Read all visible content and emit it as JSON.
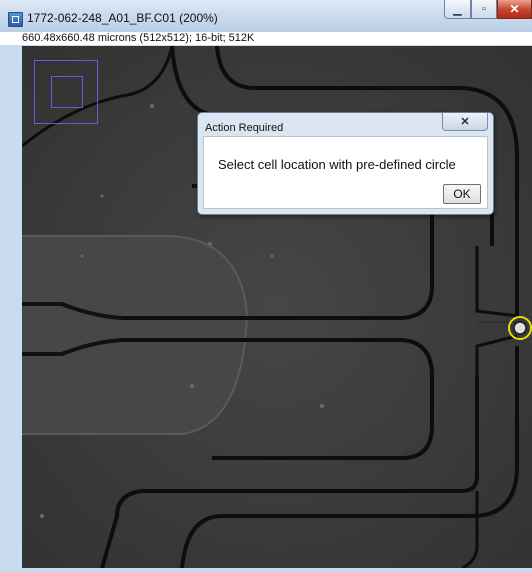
{
  "window": {
    "title": "1772-062-248_A01_BF.C01 (200%)",
    "info": "660.48x660.48 microns (512x512); 16-bit; 512K",
    "icon": "imagej-app-icon",
    "controls": {
      "minimize": "minimize-icon",
      "maximize": "maximize-icon",
      "close": "close-icon"
    }
  },
  "dialog": {
    "title": "Action Required",
    "message": "Select cell location with pre-defined circle",
    "ok_label": "OK",
    "close_glyph": "✕"
  },
  "colors": {
    "canvas_bg": "#3c3c3c",
    "channel_edge": "#0d0d0d",
    "selection_circle": "#e5e000",
    "navigator": "#6060d8"
  }
}
